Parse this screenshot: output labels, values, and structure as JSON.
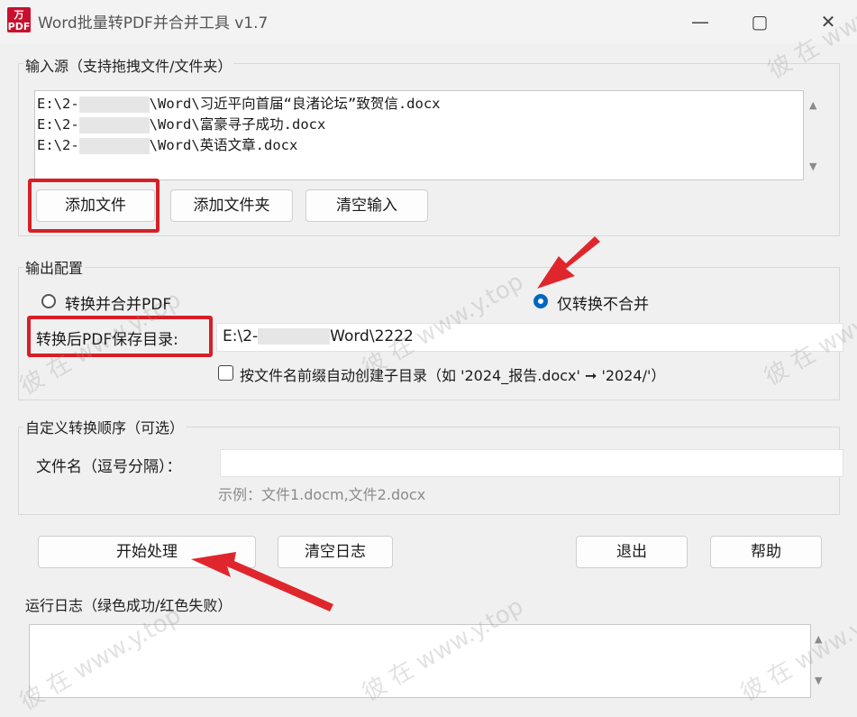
{
  "window": {
    "title": "Word批量转PDF并合并工具 v1.7",
    "app_icon_text": "万兴\n PDF",
    "minimize": "—",
    "maximize": "▢",
    "close": "✕"
  },
  "input": {
    "group_label": "输入源（支持拖拽文件/文件夹）",
    "files": [
      {
        "prefix": "E:\\2-",
        "suffix": "\\Word\\习近平向首届“良渚论坛”致贺信.docx"
      },
      {
        "prefix": "E:\\2-",
        "suffix": "\\Word\\富豪寻子成功.docx"
      },
      {
        "prefix": "E:\\2-",
        "suffix": "\\Word\\英语文章.docx"
      }
    ],
    "add_file": "添加文件",
    "add_folder": "添加文件夹",
    "clear_input": "清空输入"
  },
  "output": {
    "group_label": "输出配置",
    "radio_merge": "转换并合并PDF",
    "radio_convert_only": "仅转换不合并",
    "selected": "convert_only",
    "dir_label": "转换后PDF保存目录:",
    "dir_value_prefix": "E:\\2-",
    "dir_value_suffix": "Word\\2222",
    "subdir_checkbox": "按文件名前缀自动创建子目录（如 '2024_报告.docx' ➞ '2024/'）",
    "subdir_checked": false
  },
  "order": {
    "group_label": "自定义转换顺序（可选）",
    "filename_label": "文件名（逗号分隔）：",
    "filename_value": "",
    "example": "示例：文件1.docm,文件2.docx"
  },
  "actions": {
    "start": "开始处理",
    "clear_log": "清空日志",
    "exit": "退出",
    "help": "帮助"
  },
  "log": {
    "group_label": "运行日志（绿色成功/红色失败）"
  },
  "watermark": {
    "text": "彼 在 www.y.top"
  },
  "colors": {
    "accent": "#0067c0",
    "highlight": "#d61f26"
  }
}
